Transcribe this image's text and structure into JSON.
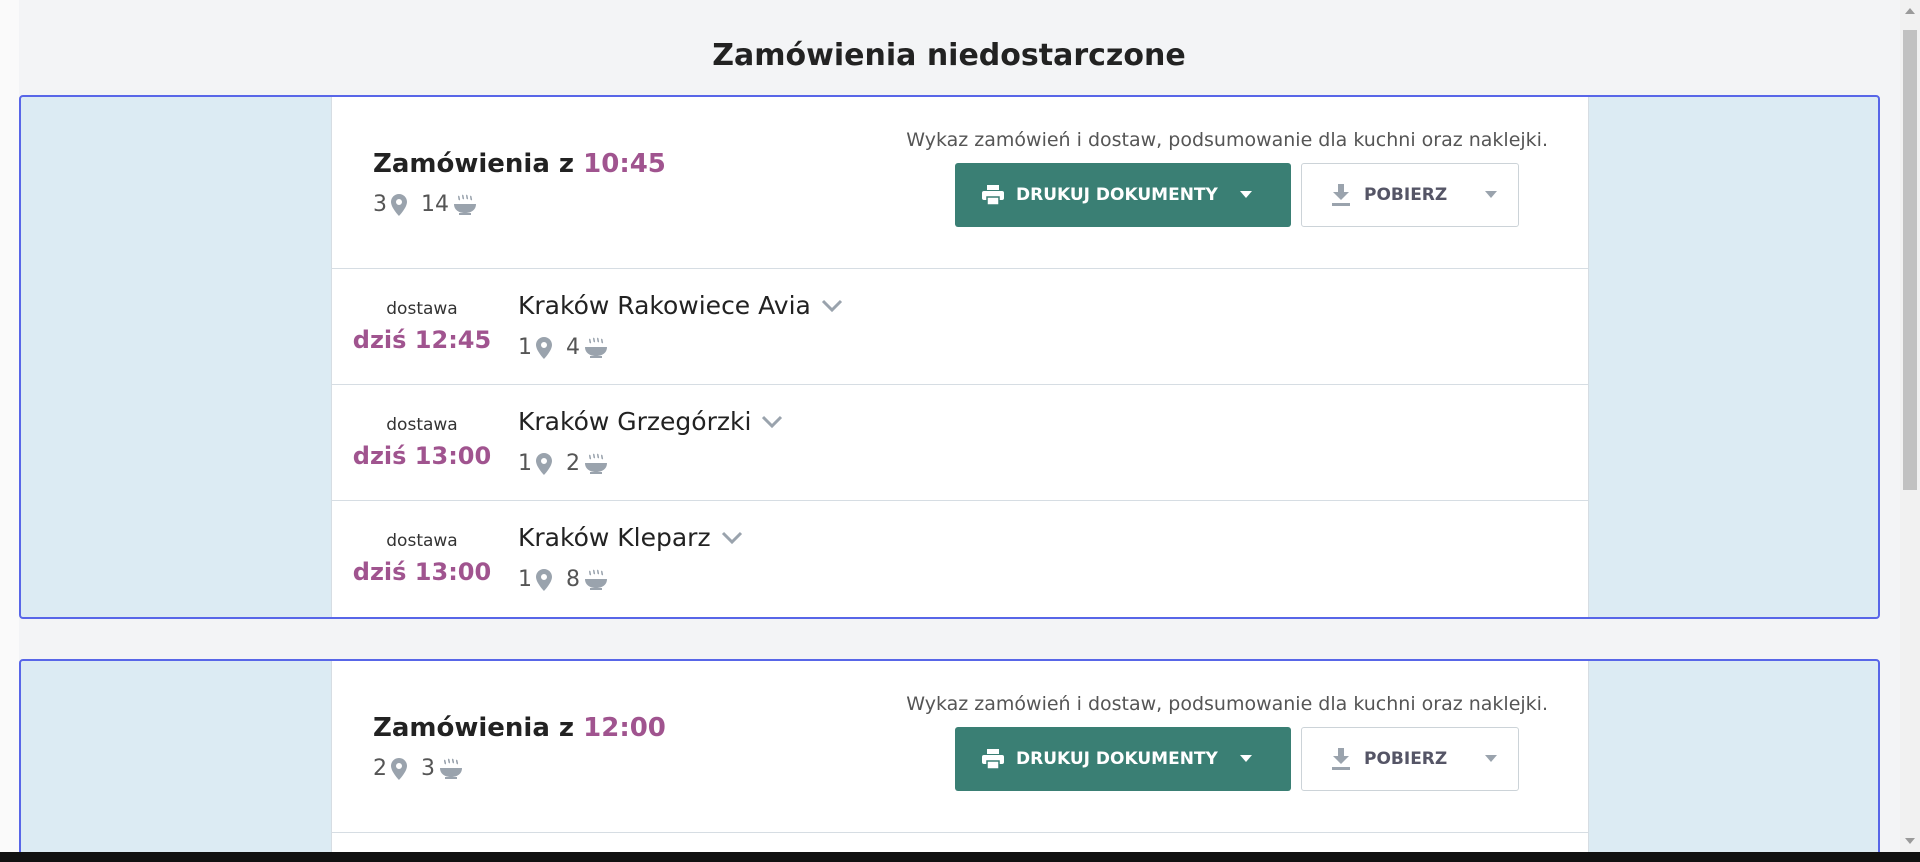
{
  "page": {
    "title": "Zamówienia niedostarczone"
  },
  "groups": [
    {
      "title_prefix": "Zamówienia z",
      "time": "10:45",
      "locations": "3",
      "meals": "14",
      "doc_description": "Wykaz zamówień i dostaw, podsumowanie dla kuchni oraz naklejki.",
      "print_label": "DRUKUJ DOKUMENTY",
      "download_label": "POBIERZ",
      "rows": [
        {
          "delivery_label": "dostawa",
          "delivery_time": "dziś 12:45",
          "name": "Kraków Rakowiece Avia",
          "locations": "1",
          "meals": "4"
        },
        {
          "delivery_label": "dostawa",
          "delivery_time": "dziś 13:00",
          "name": "Kraków Grzegórzki",
          "locations": "1",
          "meals": "2"
        },
        {
          "delivery_label": "dostawa",
          "delivery_time": "dziś 13:00",
          "name": "Kraków Kleparz",
          "locations": "1",
          "meals": "8"
        }
      ]
    },
    {
      "title_prefix": "Zamówienia z",
      "time": "12:00",
      "locations": "2",
      "meals": "3",
      "doc_description": "Wykaz zamówień i dostaw, podsumowanie dla kuchni oraz naklejki.",
      "print_label": "DRUKUJ DOKUMENTY",
      "download_label": "POBIERZ"
    }
  ],
  "icons": {
    "location": "location-pin-icon",
    "meal": "steaming-bowl-icon",
    "print": "printer-icon",
    "download": "download-icon",
    "caret": "caret-down-icon",
    "chevron": "chevron-down-icon"
  },
  "colors": {
    "accent_time": "#a0548f",
    "primary_button": "#3a7f74",
    "group_border": "#5866e8",
    "group_background": "#dcebf3"
  }
}
